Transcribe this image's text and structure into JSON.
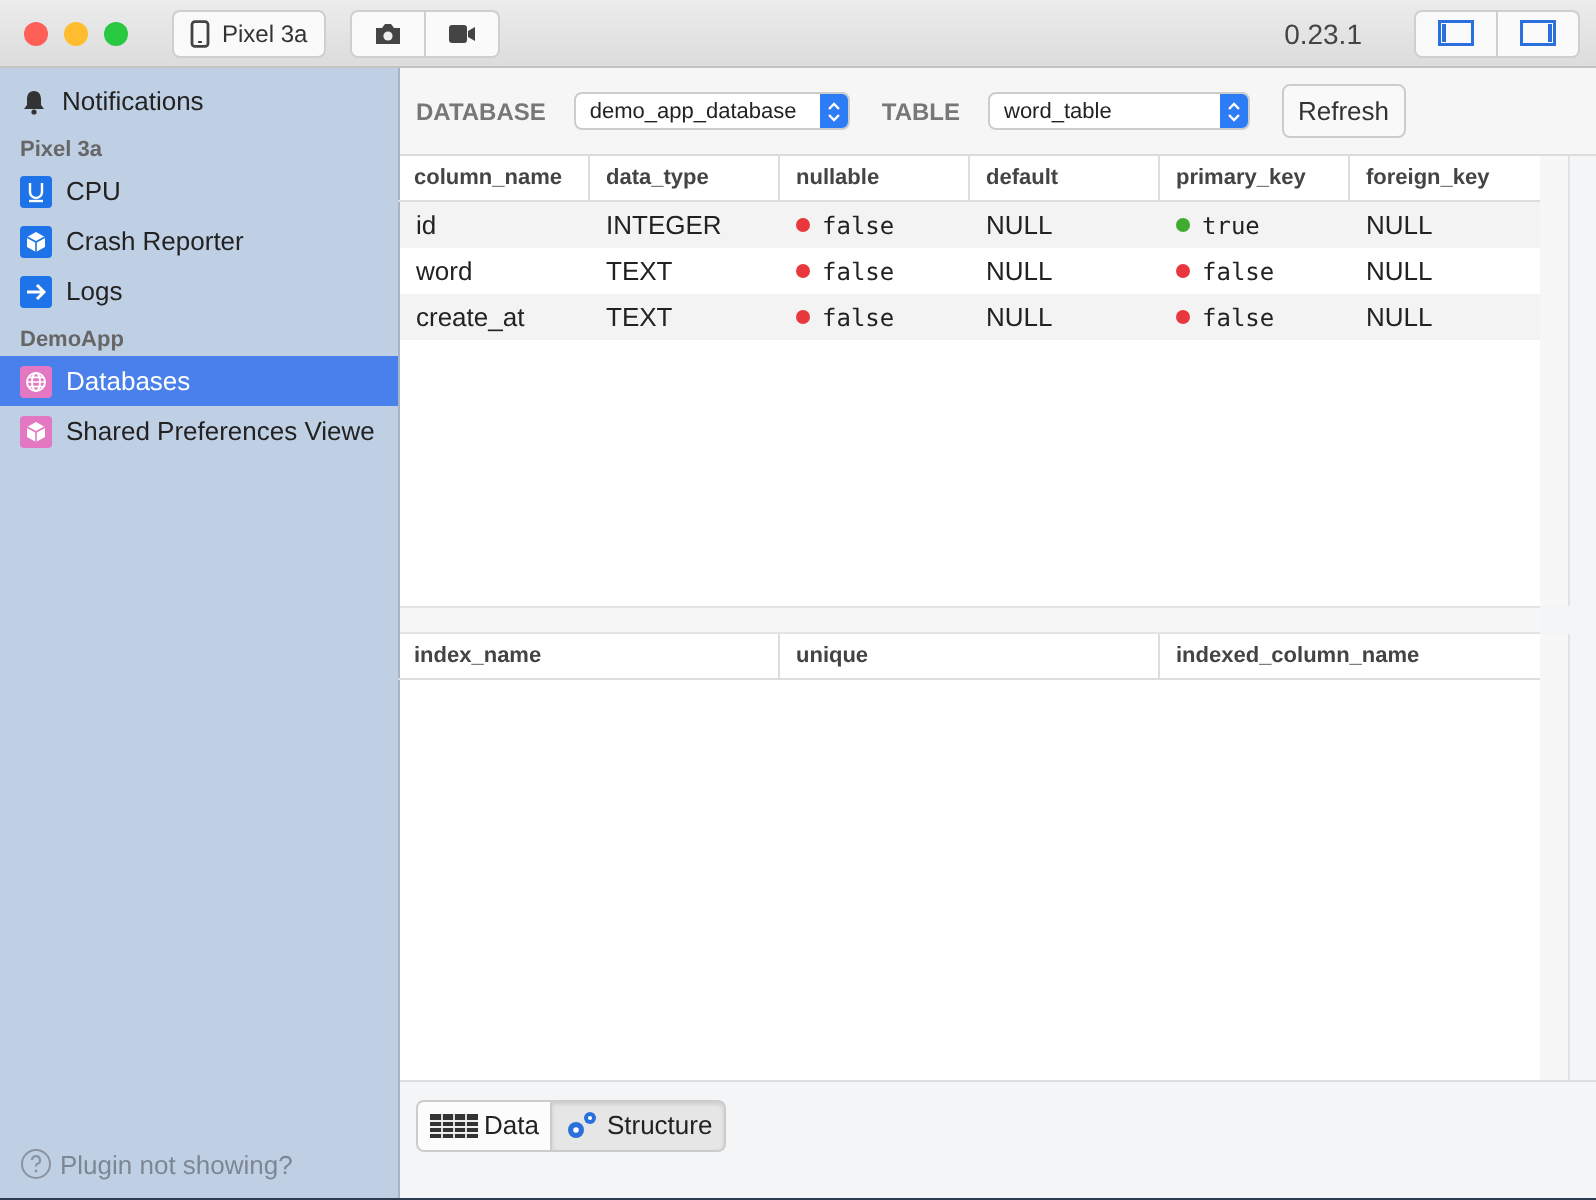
{
  "titlebar": {
    "device": "Pixel 3a",
    "version": "0.23.1",
    "panel_toggles": [
      {
        "on": true
      },
      {
        "on": true
      }
    ]
  },
  "sidebar": {
    "items": [
      {
        "kind": "plugin",
        "label": "Notifications",
        "selected": false
      },
      {
        "kind": "section",
        "label": "Pixel 3a"
      },
      {
        "kind": "plugin",
        "label": "CPU",
        "selected": false
      },
      {
        "kind": "plugin",
        "label": "Crash Reporter",
        "selected": false
      },
      {
        "kind": "plugin",
        "label": "Logs",
        "selected": false
      },
      {
        "kind": "section",
        "label": "DemoApp"
      },
      {
        "kind": "plugin",
        "label": "Databases",
        "selected": true
      },
      {
        "kind": "plugin",
        "label": "Shared Preferences Viewe",
        "selected": false
      }
    ],
    "help": "Plugin not showing?"
  },
  "toolbar": {
    "database_label": "DATABASE",
    "database": "demo_app_database",
    "table_label": "TABLE",
    "table": "word_table",
    "refresh": "Refresh"
  },
  "columns_table": {
    "columns": [
      "column_name",
      "data_type",
      "nullable",
      "default",
      "primary_key",
      "foreign_key"
    ],
    "rows": [
      [
        {
          "kind": "text",
          "text": "id"
        },
        {
          "kind": "text",
          "text": "INTEGER"
        },
        {
          "kind": "flag",
          "text": "false",
          "color": "#e8383d"
        },
        {
          "kind": "text",
          "text": "NULL"
        },
        {
          "kind": "flag",
          "text": "true",
          "color": "#3fab2f"
        },
        {
          "kind": "text",
          "text": "NULL"
        }
      ],
      [
        {
          "kind": "text",
          "text": "word"
        },
        {
          "kind": "text",
          "text": "TEXT"
        },
        {
          "kind": "flag",
          "text": "false",
          "color": "#e8383d"
        },
        {
          "kind": "text",
          "text": "NULL"
        },
        {
          "kind": "flag",
          "text": "false",
          "color": "#e8383d"
        },
        {
          "kind": "text",
          "text": "NULL"
        }
      ],
      [
        {
          "kind": "text",
          "text": "create_at"
        },
        {
          "kind": "text",
          "text": "TEXT"
        },
        {
          "kind": "flag",
          "text": "false",
          "color": "#e8383d"
        },
        {
          "kind": "text",
          "text": "NULL"
        },
        {
          "kind": "flag",
          "text": "false",
          "color": "#e8383d"
        },
        {
          "kind": "text",
          "text": "NULL"
        }
      ]
    ]
  },
  "index_table": {
    "columns": [
      "index_name",
      "unique",
      "indexed_column_name"
    ]
  },
  "view_tabs": [
    {
      "label": "Data",
      "selected": false
    },
    {
      "label": "Structure",
      "selected": true
    }
  ]
}
